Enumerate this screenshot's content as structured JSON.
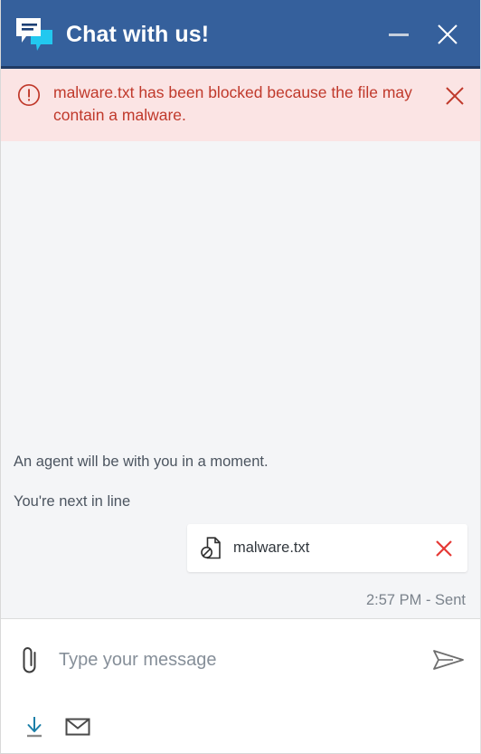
{
  "window": {
    "title": "Chat with us!",
    "header_bg": "#35609c",
    "minimize_label": "Minimize",
    "close_label": "Close",
    "brand_icon": "chat-bubbles-icon"
  },
  "alert": {
    "icon": "exclamation-circle-icon",
    "message": "malware.txt has been blocked because the file may contain a malware.",
    "close_icon": "close-icon",
    "bg_color": "#fbe4e4",
    "text_color": "#c0392b"
  },
  "conversation": {
    "system_messages": [
      "An agent will be with you in a moment.",
      "You're next in line"
    ],
    "attachment": {
      "icon": "blocked-file-icon",
      "filename": "malware.txt",
      "remove_icon": "close-icon",
      "remove_color": "#e53935"
    },
    "status": "2:57 PM - Sent"
  },
  "composer": {
    "attach_icon": "paperclip-icon",
    "input_value": "",
    "placeholder": "Type your message",
    "send_icon": "send-plane-icon"
  },
  "toolbar": {
    "download_icon": "download-icon",
    "download_color": "#1b7fa8",
    "email_icon": "envelope-icon",
    "email_color": "#4a4a4a"
  }
}
